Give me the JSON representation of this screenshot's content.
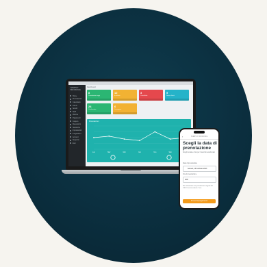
{
  "dashboard": {
    "breadcrumb": "Dashboard",
    "sidebar_logo": "SIMPLY BOOKING",
    "sidebar_items": [
      "Home",
      "Prenotazioni",
      "Calendario",
      "Clienti",
      "Servizi",
      "Staff",
      "Risorse",
      "Pagamenti",
      "Coupon",
      "Recensioni",
      "Statistiche",
      "Impostazioni",
      "Integrazioni",
      "Account",
      "Supporto",
      "Esci"
    ],
    "cards": [
      {
        "value": "8",
        "label": "Prenotazioni oggi",
        "color": "#2bb673"
      },
      {
        "value": "12",
        "label": "In attesa",
        "color": "#f2b233"
      },
      {
        "value": "3",
        "label": "Cancellate",
        "color": "#e5484d"
      },
      {
        "value": "5",
        "label": "Nuovi clienti",
        "color": "#25b3c9"
      },
      {
        "value": "24",
        "label": "Confermate",
        "color": "#2bb673"
      },
      {
        "value": "6",
        "label": "Da pagare",
        "color": "#f2b233"
      }
    ],
    "chart_header": "Prenotazioni",
    "chart_panel_color": "#1fb2ad"
  },
  "chart_data": {
    "type": "line",
    "x": [
      "Lun",
      "Mar",
      "Mer",
      "Gio",
      "Ven",
      "Sab",
      "Dom"
    ],
    "series": [
      {
        "values": [
          4,
          4.5,
          3.5,
          3,
          6,
          3.5,
          4
        ]
      }
    ],
    "ylim": [
      0,
      8
    ]
  },
  "phone": {
    "back_icon": "‹",
    "brand": "SIMPLY BOOKING",
    "title": "Scegli la data di prenotazione",
    "subtitle": "Scegli la data e l'ora per il servizio selezionato",
    "date_label": "Data di prenotazione",
    "date_value": "Giovedì, 16 Febbraio 2023",
    "time_label": "Ora di prenotazione",
    "time_value": "9:00",
    "note": "Hai selezionato una prenotazione singola alle 9:00. Il servizio durerà 1 ora.",
    "button_label": "Procedi al pagamento",
    "accent_color": "#f39a1a"
  }
}
